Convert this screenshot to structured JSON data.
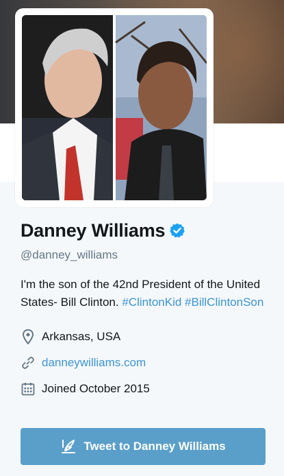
{
  "profile": {
    "name": "Danney Williams",
    "handle": "@danney_williams",
    "bio_text": "I'm the son of the 42nd President of the United States- Bill Clinton.",
    "bio_hashtag_1": "#ClintonKid",
    "bio_hashtag_2": "#BillClintonSon",
    "location": "Arkansas, USA",
    "website": "danneywilliams.com",
    "joined": "Joined October 2015"
  },
  "actions": {
    "tweet_to_label": "Tweet to Danney Williams"
  },
  "icons": {
    "verified": "verified-badge-icon",
    "location": "location-pin-icon",
    "link": "link-icon",
    "calendar": "calendar-icon",
    "compose": "compose-feather-icon"
  },
  "colors": {
    "accent": "#3b94d9",
    "verified": "#1da1f2",
    "button": "#5a9fc9",
    "secondary_text": "#657786"
  }
}
